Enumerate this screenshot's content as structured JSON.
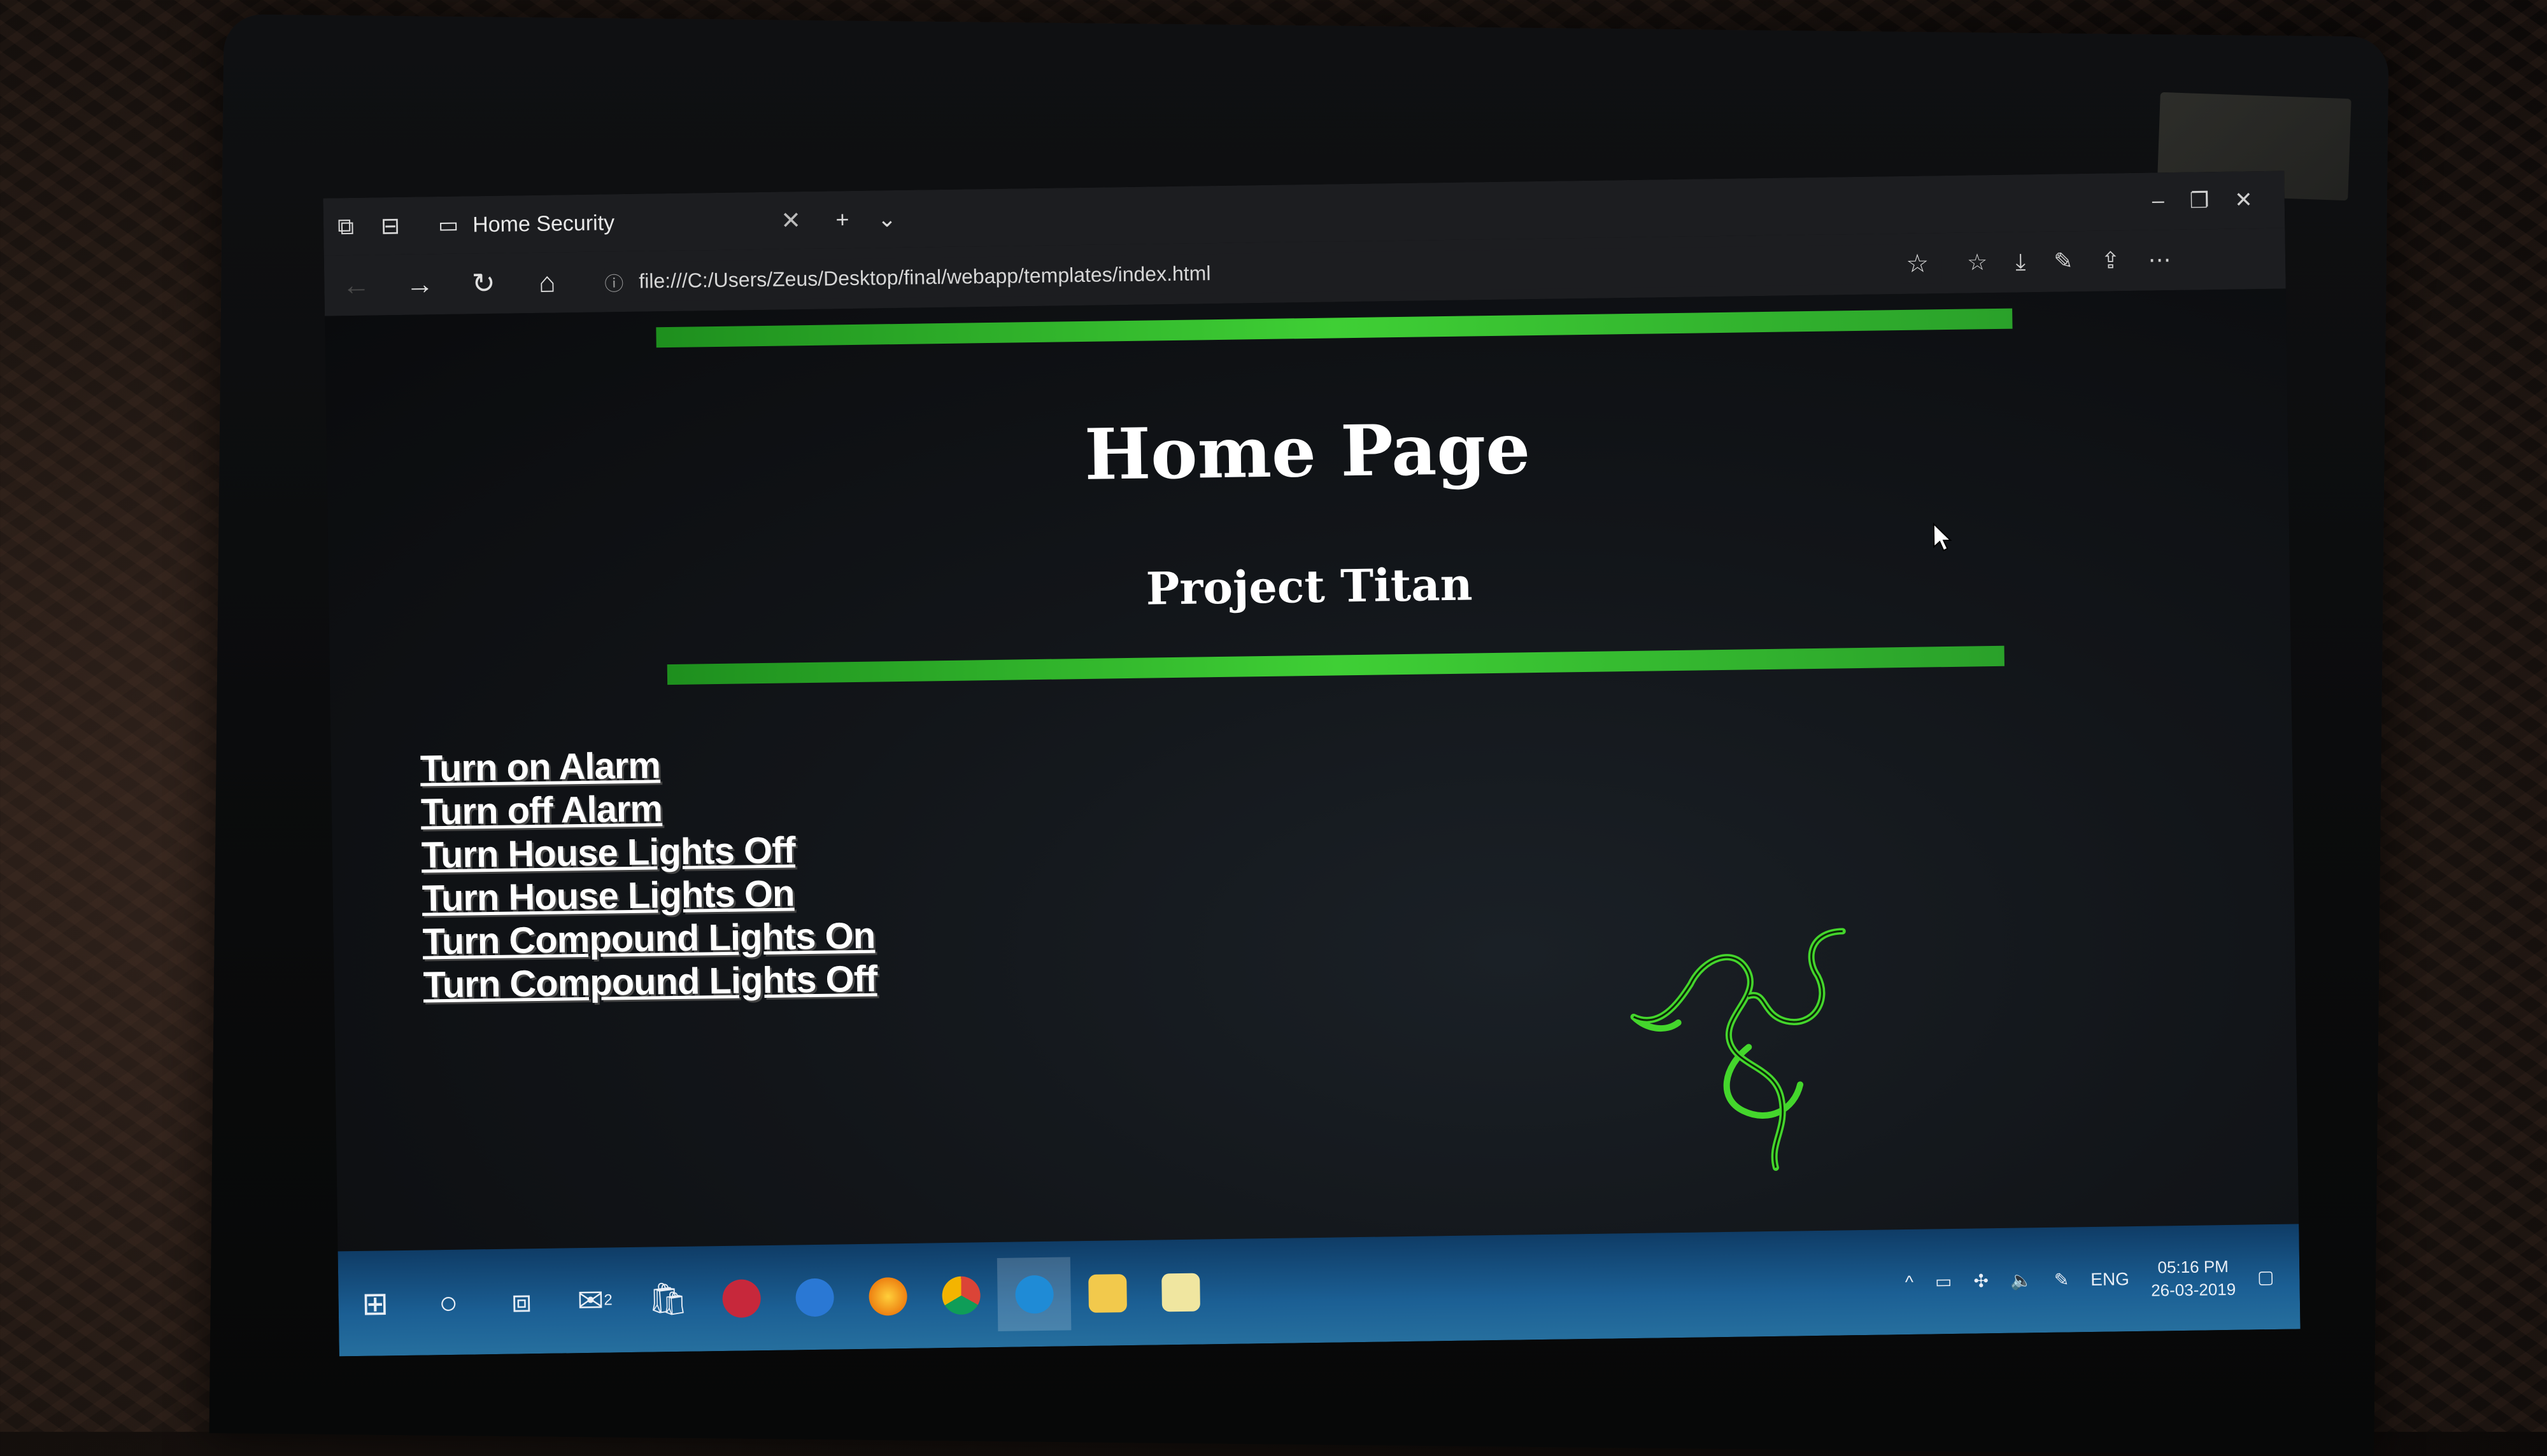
{
  "browser": {
    "tab_title": "Home Security",
    "url": "file:///C:/Users/Zeus/Desktop/final/webapp/templates/index.html"
  },
  "page": {
    "heading": "Home Page",
    "subheading": "Project Titan",
    "links": [
      "Turn on Alarm",
      "Turn off Alarm",
      "Turn House Lights Off",
      "Turn House Lights On",
      "Turn Compound Lights On",
      "Turn Compound Lights Off"
    ]
  },
  "taskbar": {
    "language": "ENG",
    "time": "05:16 PM",
    "date": "26-03-2019",
    "mail_badge": "2"
  },
  "colors": {
    "accent_bar": "#3fcf35",
    "logo_green": "#44d62c",
    "taskbar": "#1b5f94"
  }
}
